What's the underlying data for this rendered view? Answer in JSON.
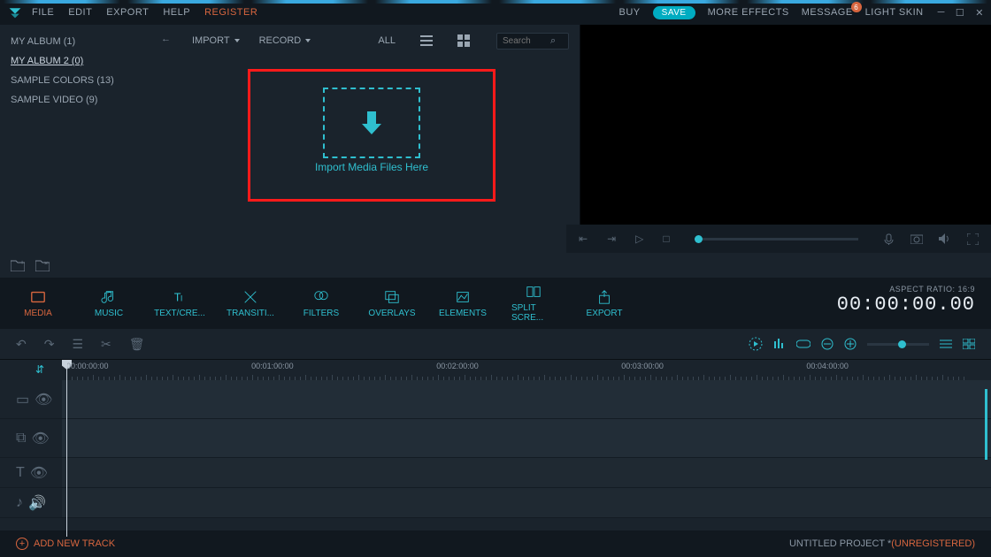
{
  "menu": {
    "file": "FILE",
    "edit": "EDIT",
    "export": "EXPORT",
    "help": "HELP",
    "register": "REGISTER",
    "buy": "BUY",
    "save": "SAVE",
    "more_effects": "MORE EFFECTS",
    "message": "MESSAGE",
    "message_badge": "6",
    "light_skin": "LIGHT SKIN"
  },
  "sidebar": {
    "albums": [
      {
        "label": "MY ALBUM (1)",
        "selected": false
      },
      {
        "label": "MY ALBUM 2 (0)",
        "selected": true
      },
      {
        "label": "SAMPLE COLORS (13)",
        "selected": false
      },
      {
        "label": "SAMPLE VIDEO (9)",
        "selected": false
      }
    ]
  },
  "media_toolbar": {
    "import": "IMPORT",
    "record": "RECORD",
    "all": "ALL",
    "search_placeholder": "Search"
  },
  "drop": {
    "label": "Import Media Files Here"
  },
  "categories": [
    {
      "id": "media",
      "label": "MEDIA",
      "active": true
    },
    {
      "id": "music",
      "label": "MUSIC",
      "active": false
    },
    {
      "id": "text",
      "label": "TEXT/CRE...",
      "active": false
    },
    {
      "id": "transitions",
      "label": "TRANSITI...",
      "active": false
    },
    {
      "id": "filters",
      "label": "FILTERS",
      "active": false
    },
    {
      "id": "overlays",
      "label": "OVERLAYS",
      "active": false
    },
    {
      "id": "elements",
      "label": "ELEMENTS",
      "active": false
    },
    {
      "id": "splitscreen",
      "label": "SPLIT SCRE...",
      "active": false
    },
    {
      "id": "export",
      "label": "EXPORT",
      "active": false
    }
  ],
  "timecode": {
    "aspect": "ASPECT RATIO: 16:9",
    "value": "00:00:00.00"
  },
  "ruler": {
    "marks": [
      "00:00:00:00",
      "00:01:00:00",
      "00:02:00:00",
      "00:03:00:00",
      "00:04:00:00"
    ]
  },
  "status": {
    "add_track": "ADD NEW TRACK",
    "project": "UNTITLED PROJECT * ",
    "unregistered": "(UNREGISTERED)"
  }
}
